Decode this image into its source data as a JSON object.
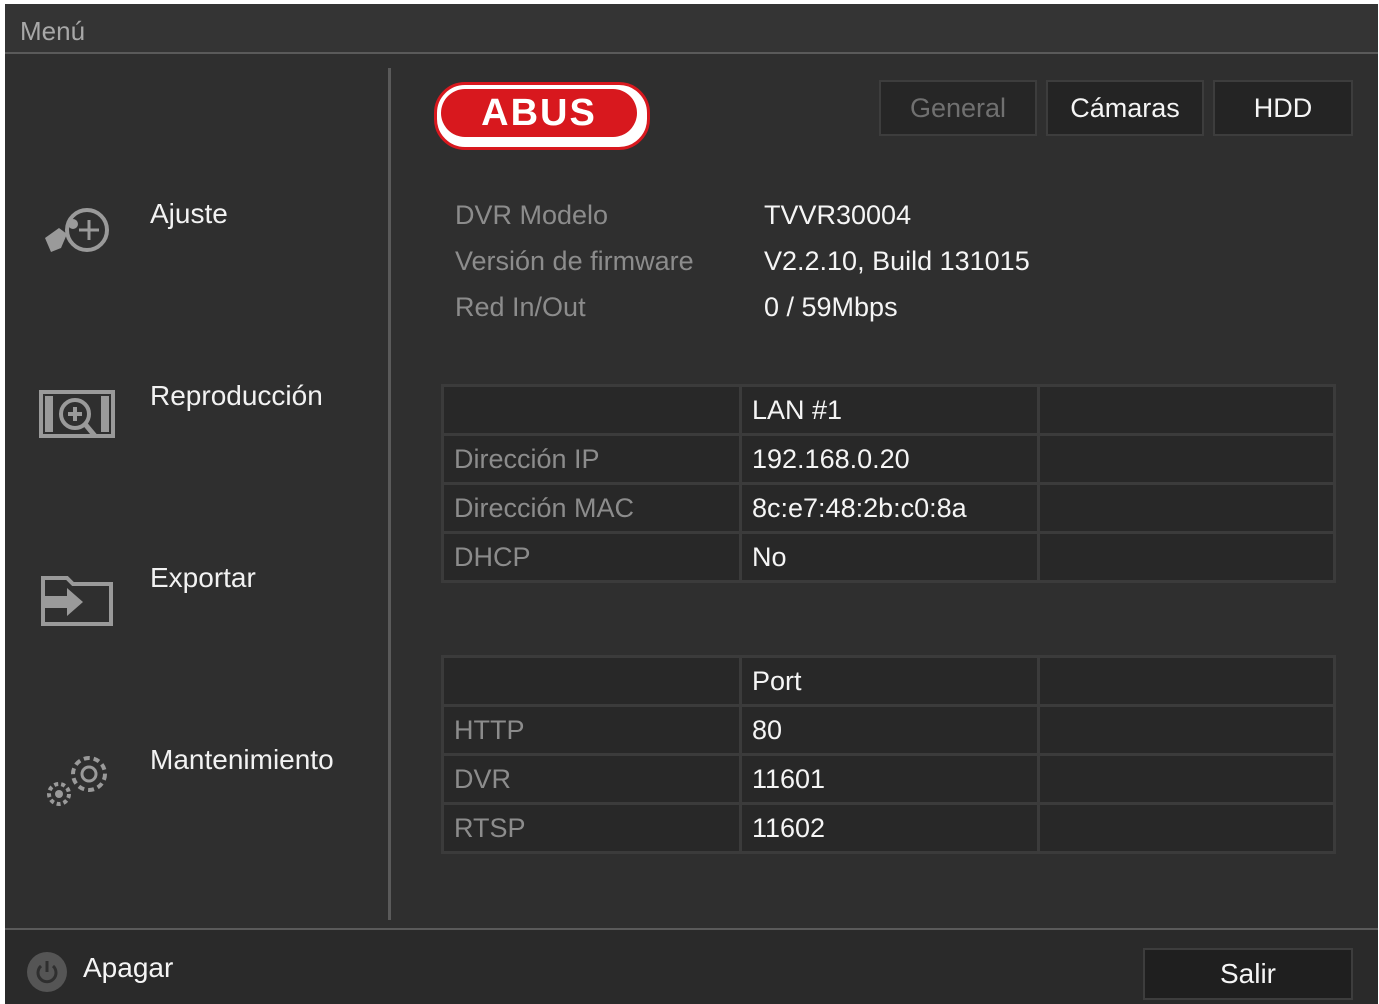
{
  "window": {
    "title": "Menú"
  },
  "sidebar": {
    "items": [
      {
        "label": "Ajuste",
        "icon": "settings-icon"
      },
      {
        "label": "Reproducción",
        "icon": "playback-icon"
      },
      {
        "label": "Exportar",
        "icon": "export-icon"
      },
      {
        "label": "Mantenimiento",
        "icon": "maintenance-icon"
      }
    ]
  },
  "brand": {
    "logo_text": "ABUS",
    "color": "#d8181e"
  },
  "tabs": [
    {
      "label": "General",
      "state": "disabled"
    },
    {
      "label": "Cámaras",
      "state": "enabled"
    },
    {
      "label": "HDD",
      "state": "enabled"
    }
  ],
  "device_info": [
    {
      "key": "DVR Modelo",
      "value": "TVVR30004"
    },
    {
      "key": "Versión de firmware",
      "value": "V2.2.10, Build 131015"
    },
    {
      "key": "Red In/Out",
      "value": "0 / 59Mbps"
    }
  ],
  "lan_table": {
    "header": [
      "",
      "LAN #1",
      ""
    ],
    "rows": [
      [
        "Dirección IP",
        "192.168.0.20",
        ""
      ],
      [
        "Dirección MAC",
        "8c:e7:48:2b:c0:8a",
        ""
      ],
      [
        "DHCP",
        "No",
        ""
      ]
    ]
  },
  "port_table": {
    "header": [
      "",
      "Port",
      ""
    ],
    "rows": [
      [
        "HTTP",
        "80",
        ""
      ],
      [
        "DVR",
        "11601",
        ""
      ],
      [
        "RTSP",
        "11602",
        ""
      ]
    ]
  },
  "footer": {
    "power_label": "Apagar",
    "exit_label": "Salir"
  }
}
